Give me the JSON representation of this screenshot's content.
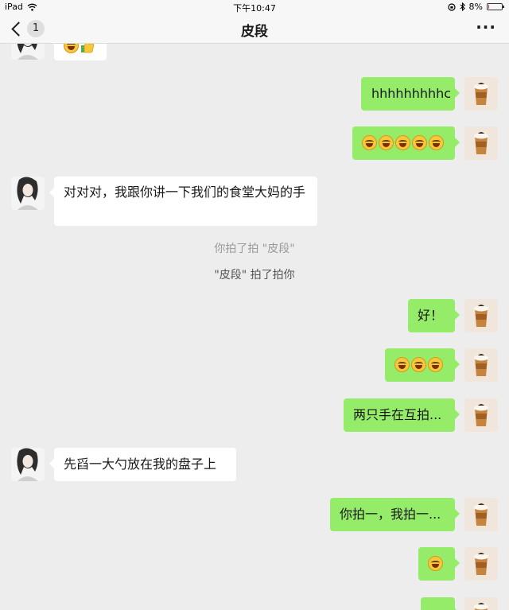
{
  "status_bar": {
    "device": "iPad",
    "time": "下午10:47",
    "battery_text": "8%",
    "battery_level": 0.08
  },
  "nav": {
    "back_badge": "1",
    "title": "皮段",
    "more": "···"
  },
  "messages": {
    "m1": {
      "text": "hhhhhhhhhc"
    },
    "m2": {
      "emoji_count": 5
    },
    "m3": {
      "text": "对对对，我跟你讲一下我们的食堂大妈的手"
    },
    "m4": {
      "text": "你拍了拍 \"皮段\""
    },
    "m5": {
      "text": "\"皮段\" 拍了拍你"
    },
    "m6": {
      "text": "好！"
    },
    "m7": {
      "emoji_count": 3
    },
    "m8": {
      "text": "两只手在互拍..."
    },
    "m9": {
      "text": "先舀一大勺放在我的盘子上"
    },
    "m10": {
      "text": "你拍一，我拍一..."
    },
    "m11": {
      "emoji_count": 1
    }
  },
  "colors": {
    "self_bubble": "#95ec69",
    "other_bubble": "#ffffff",
    "background": "#ededed"
  }
}
